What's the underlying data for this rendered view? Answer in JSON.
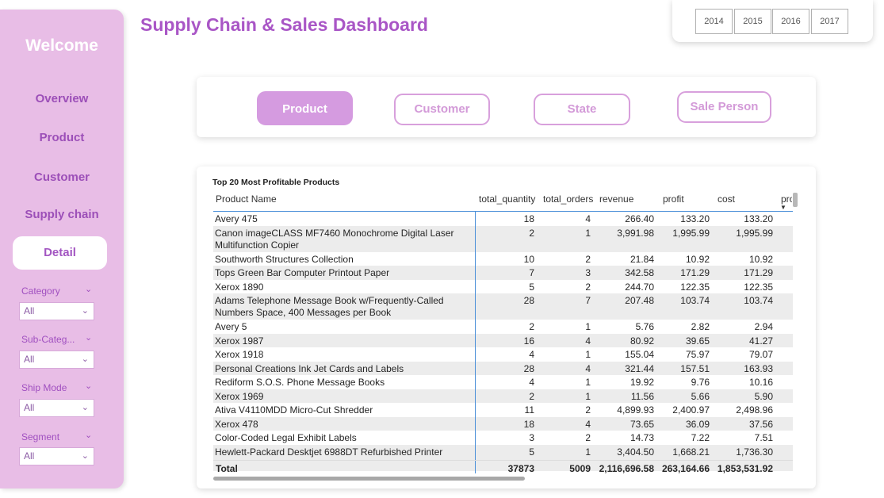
{
  "sidebar": {
    "welcome": "Welcome",
    "nav": [
      "Overview",
      "Product",
      "Customer",
      "Supply chain"
    ],
    "active": "Detail",
    "filters": [
      {
        "label": "Category",
        "value": "All"
      },
      {
        "label": "Sub-Categ...",
        "value": "All"
      },
      {
        "label": "Ship Mode",
        "value": "All"
      },
      {
        "label": "Segment",
        "value": "All"
      }
    ]
  },
  "header": {
    "title": "Supply Chain & Sales Dashboard",
    "years": [
      "2014",
      "2015",
      "2016",
      "2017"
    ]
  },
  "tabs": [
    "Product",
    "Customer",
    "State",
    "Sale Person"
  ],
  "table": {
    "title": "Top 20 Most Profitable Products",
    "columns": [
      "Product Name",
      "total_quantity",
      "total_orders",
      "revenue",
      "profit",
      "cost",
      "pro"
    ],
    "rows": [
      {
        "name": "Avery 475",
        "qty": "18",
        "orders": "4",
        "revenue": "266.40",
        "profit": "133.20",
        "cost": "133.20"
      },
      {
        "name": "Canon imageCLASS MF7460 Monochrome Digital Laser Multifunction Copier",
        "qty": "2",
        "orders": "1",
        "revenue": "3,991.98",
        "profit": "1,995.99",
        "cost": "1,995.99"
      },
      {
        "name": "Southworth Structures Collection",
        "qty": "10",
        "orders": "2",
        "revenue": "21.84",
        "profit": "10.92",
        "cost": "10.92"
      },
      {
        "name": "Tops Green Bar Computer Printout Paper",
        "qty": "7",
        "orders": "3",
        "revenue": "342.58",
        "profit": "171.29",
        "cost": "171.29"
      },
      {
        "name": "Xerox 1890",
        "qty": "5",
        "orders": "2",
        "revenue": "244.70",
        "profit": "122.35",
        "cost": "122.35"
      },
      {
        "name": "Adams Telephone Message Book w/Frequently-Called Numbers Space, 400 Messages per Book",
        "qty": "28",
        "orders": "7",
        "revenue": "207.48",
        "profit": "103.74",
        "cost": "103.74"
      },
      {
        "name": "Avery 5",
        "qty": "2",
        "orders": "1",
        "revenue": "5.76",
        "profit": "2.82",
        "cost": "2.94"
      },
      {
        "name": "Xerox 1987",
        "qty": "16",
        "orders": "4",
        "revenue": "80.92",
        "profit": "39.65",
        "cost": "41.27"
      },
      {
        "name": "Xerox 1918",
        "qty": "4",
        "orders": "1",
        "revenue": "155.04",
        "profit": "75.97",
        "cost": "79.07"
      },
      {
        "name": "Personal Creations Ink Jet Cards and Labels",
        "qty": "28",
        "orders": "4",
        "revenue": "321.44",
        "profit": "157.51",
        "cost": "163.93"
      },
      {
        "name": "Rediform S.O.S. Phone Message Books",
        "qty": "4",
        "orders": "1",
        "revenue": "19.92",
        "profit": "9.76",
        "cost": "10.16"
      },
      {
        "name": "Xerox 1969",
        "qty": "2",
        "orders": "1",
        "revenue": "11.56",
        "profit": "5.66",
        "cost": "5.90"
      },
      {
        "name": "Ativa V4110MDD Micro-Cut Shredder",
        "qty": "11",
        "orders": "2",
        "revenue": "4,899.93",
        "profit": "2,400.97",
        "cost": "2,498.96"
      },
      {
        "name": "Xerox 478",
        "qty": "18",
        "orders": "4",
        "revenue": "73.65",
        "profit": "36.09",
        "cost": "37.56"
      },
      {
        "name": "Color-Coded Legal Exhibit Labels",
        "qty": "3",
        "orders": "2",
        "revenue": "14.73",
        "profit": "7.22",
        "cost": "7.51"
      },
      {
        "name": "Hewlett-Packard Desktjet 6988DT Refurbished Printer",
        "qty": "5",
        "orders": "1",
        "revenue": "3,404.50",
        "profit": "1,668.21",
        "cost": "1,736.30"
      }
    ],
    "total": {
      "label": "Total",
      "qty": "37873",
      "orders": "5009",
      "revenue": "2,116,696.58",
      "profit": "263,164.66",
      "cost": "1,853,531.92"
    }
  }
}
